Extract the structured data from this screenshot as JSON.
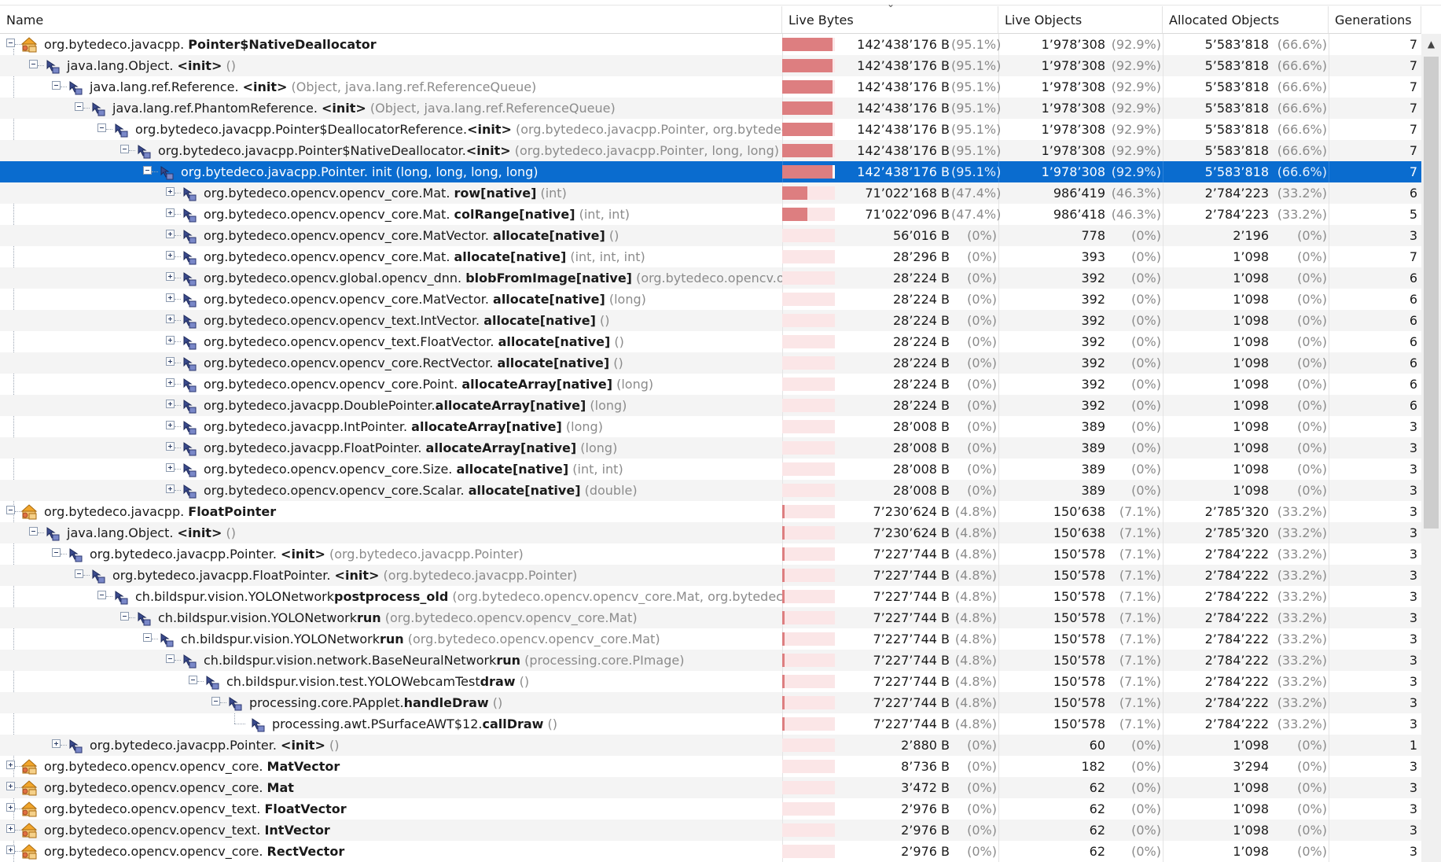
{
  "columns": {
    "name": "Name",
    "live_bytes": "Live Bytes",
    "live_objects": "Live Objects",
    "allocated_objects": "Allocated Objects",
    "generations": "Generations"
  },
  "colors": {
    "bar": "#dd7e80",
    "bar_bg": "#fbe6e7",
    "selected": "#0a6ccf"
  },
  "rows": [
    {
      "depth": 0,
      "toggle": "minus",
      "icon": "class-icon",
      "pkg": "org.bytedeco.javacpp. ",
      "meth": "Pointer$NativeDeallocator",
      "args": "",
      "bytes": "142’438’176 B",
      "bytes_pct": "(95.1%)",
      "bar": 0.95,
      "objs": "1’978’308",
      "objs_pct": "(92.9%)",
      "alloc": "5’583’818",
      "alloc_pct": "(66.6%)",
      "gen": "7"
    },
    {
      "depth": 1,
      "toggle": "minus",
      "icon": "method-icon",
      "pkg": "java.lang.Object. ",
      "meth": "<init>",
      "args": " ()",
      "bytes": "142’438’176 B",
      "bytes_pct": "(95.1%)",
      "bar": 0.95,
      "objs": "1’978’308",
      "objs_pct": "(92.9%)",
      "alloc": "5’583’818",
      "alloc_pct": "(66.6%)",
      "gen": "7"
    },
    {
      "depth": 2,
      "toggle": "minus",
      "icon": "method-icon",
      "pkg": "java.lang.ref.Reference. ",
      "meth": "<init>",
      "args": " (Object, java.lang.ref.ReferenceQueue)",
      "bytes": "142’438’176 B",
      "bytes_pct": "(95.1%)",
      "bar": 0.95,
      "objs": "1’978’308",
      "objs_pct": "(92.9%)",
      "alloc": "5’583’818",
      "alloc_pct": "(66.6%)",
      "gen": "7"
    },
    {
      "depth": 3,
      "toggle": "minus",
      "icon": "method-icon",
      "pkg": "java.lang.ref.PhantomReference. ",
      "meth": "<init>",
      "args": " (Object, java.lang.ref.ReferenceQueue)",
      "bytes": "142’438’176 B",
      "bytes_pct": "(95.1%)",
      "bar": 0.95,
      "objs": "1’978’308",
      "objs_pct": "(92.9%)",
      "alloc": "5’583’818",
      "alloc_pct": "(66.6%)",
      "gen": "7"
    },
    {
      "depth": 4,
      "toggle": "minus",
      "icon": "method-icon",
      "pkg": "org.bytedeco.javacpp.Pointer$DeallocatorReference.",
      "meth": "<init>",
      "args": " (org.bytedeco.javacpp.Pointer, org.bytedeco.java",
      "bytes": "142’438’176 B",
      "bytes_pct": "(95.1%)",
      "bar": 0.95,
      "objs": "1’978’308",
      "objs_pct": "(92.9%)",
      "alloc": "5’583’818",
      "alloc_pct": "(66.6%)",
      "gen": "7"
    },
    {
      "depth": 5,
      "toggle": "minus",
      "icon": "method-icon",
      "pkg": "org.bytedeco.javacpp.Pointer$NativeDeallocator.",
      "meth": "<init>",
      "args": " (org.bytedeco.javacpp.Pointer, long, long)",
      "bytes": "142’438’176 B",
      "bytes_pct": "(95.1%)",
      "bar": 0.95,
      "objs": "1’978’308",
      "objs_pct": "(92.9%)",
      "alloc": "5’583’818",
      "alloc_pct": "(66.6%)",
      "gen": "7"
    },
    {
      "depth": 6,
      "toggle": "minus",
      "icon": "method-icon",
      "pkg": "org.bytedeco.javacpp.Pointer. ",
      "meth": "",
      "args": "",
      "plain": "init (long, long, long, long)",
      "bytes": "142’438’176 B",
      "bytes_pct": "(95.1%)",
      "bar": 0.95,
      "objs": "1’978’308",
      "objs_pct": "(92.9%)",
      "alloc": "5’583’818",
      "alloc_pct": "(66.6%)",
      "gen": "7",
      "selected": true
    },
    {
      "depth": 7,
      "toggle": "plus",
      "icon": "method-icon",
      "pkg": "org.bytedeco.opencv.opencv_core.Mat. ",
      "meth": "row[native]",
      "args": " (int)",
      "bytes": "71’022’168 B",
      "bytes_pct": "(47.4%)",
      "bar": 0.474,
      "objs": "986’419",
      "objs_pct": "(46.3%)",
      "alloc": "2’784’223",
      "alloc_pct": "(33.2%)",
      "gen": "6"
    },
    {
      "depth": 7,
      "toggle": "plus",
      "icon": "method-icon",
      "pkg": "org.bytedeco.opencv.opencv_core.Mat. ",
      "meth": "colRange[native]",
      "args": " (int, int)",
      "bytes": "71’022’096 B",
      "bytes_pct": "(47.4%)",
      "bar": 0.474,
      "objs": "986’418",
      "objs_pct": "(46.3%)",
      "alloc": "2’784’223",
      "alloc_pct": "(33.2%)",
      "gen": "5"
    },
    {
      "depth": 7,
      "toggle": "plus",
      "icon": "method-icon",
      "pkg": "org.bytedeco.opencv.opencv_core.MatVector. ",
      "meth": "allocate[native]",
      "args": " ()",
      "bytes": "56’016 B",
      "bytes_pct": "(0%)",
      "bar": 0,
      "objs": "778",
      "objs_pct": "(0%)",
      "alloc": "2’196",
      "alloc_pct": "(0%)",
      "gen": "3"
    },
    {
      "depth": 7,
      "toggle": "plus",
      "icon": "method-icon",
      "pkg": "org.bytedeco.opencv.opencv_core.Mat. ",
      "meth": "allocate[native]",
      "args": " (int, int, int)",
      "bytes": "28’296 B",
      "bytes_pct": "(0%)",
      "bar": 0,
      "objs": "393",
      "objs_pct": "(0%)",
      "alloc": "1’098",
      "alloc_pct": "(0%)",
      "gen": "7"
    },
    {
      "depth": 7,
      "toggle": "plus",
      "icon": "method-icon",
      "pkg": "org.bytedeco.opencv.global.opencv_dnn. ",
      "meth": "blobFromImage[native]",
      "args": " (org.bytedeco.opencv.openc",
      "bytes": "28’224 B",
      "bytes_pct": "(0%)",
      "bar": 0,
      "objs": "392",
      "objs_pct": "(0%)",
      "alloc": "1’098",
      "alloc_pct": "(0%)",
      "gen": "6"
    },
    {
      "depth": 7,
      "toggle": "plus",
      "icon": "method-icon",
      "pkg": "org.bytedeco.opencv.opencv_core.MatVector. ",
      "meth": "allocate[native]",
      "args": " (long)",
      "bytes": "28’224 B",
      "bytes_pct": "(0%)",
      "bar": 0,
      "objs": "392",
      "objs_pct": "(0%)",
      "alloc": "1’098",
      "alloc_pct": "(0%)",
      "gen": "6"
    },
    {
      "depth": 7,
      "toggle": "plus",
      "icon": "method-icon",
      "pkg": "org.bytedeco.opencv.opencv_text.IntVector. ",
      "meth": "allocate[native]",
      "args": " ()",
      "bytes": "28’224 B",
      "bytes_pct": "(0%)",
      "bar": 0,
      "objs": "392",
      "objs_pct": "(0%)",
      "alloc": "1’098",
      "alloc_pct": "(0%)",
      "gen": "6"
    },
    {
      "depth": 7,
      "toggle": "plus",
      "icon": "method-icon",
      "pkg": "org.bytedeco.opencv.opencv_text.FloatVector. ",
      "meth": "allocate[native]",
      "args": " ()",
      "bytes": "28’224 B",
      "bytes_pct": "(0%)",
      "bar": 0,
      "objs": "392",
      "objs_pct": "(0%)",
      "alloc": "1’098",
      "alloc_pct": "(0%)",
      "gen": "6"
    },
    {
      "depth": 7,
      "toggle": "plus",
      "icon": "method-icon",
      "pkg": "org.bytedeco.opencv.opencv_core.RectVector. ",
      "meth": "allocate[native]",
      "args": " ()",
      "bytes": "28’224 B",
      "bytes_pct": "(0%)",
      "bar": 0,
      "objs": "392",
      "objs_pct": "(0%)",
      "alloc": "1’098",
      "alloc_pct": "(0%)",
      "gen": "6"
    },
    {
      "depth": 7,
      "toggle": "plus",
      "icon": "method-icon",
      "pkg": "org.bytedeco.opencv.opencv_core.Point. ",
      "meth": "allocateArray[native]",
      "args": " (long)",
      "bytes": "28’224 B",
      "bytes_pct": "(0%)",
      "bar": 0,
      "objs": "392",
      "objs_pct": "(0%)",
      "alloc": "1’098",
      "alloc_pct": "(0%)",
      "gen": "6"
    },
    {
      "depth": 7,
      "toggle": "plus",
      "icon": "method-icon",
      "pkg": "org.bytedeco.javacpp.DoublePointer.",
      "meth": "allocateArray[native]",
      "args": " (long)",
      "bytes": "28’224 B",
      "bytes_pct": "(0%)",
      "bar": 0,
      "objs": "392",
      "objs_pct": "(0%)",
      "alloc": "1’098",
      "alloc_pct": "(0%)",
      "gen": "6"
    },
    {
      "depth": 7,
      "toggle": "plus",
      "icon": "method-icon",
      "pkg": "org.bytedeco.javacpp.IntPointer. ",
      "meth": "allocateArray[native]",
      "args": " (long)",
      "bytes": "28’008 B",
      "bytes_pct": "(0%)",
      "bar": 0,
      "objs": "389",
      "objs_pct": "(0%)",
      "alloc": "1’098",
      "alloc_pct": "(0%)",
      "gen": "3"
    },
    {
      "depth": 7,
      "toggle": "plus",
      "icon": "method-icon",
      "pkg": "org.bytedeco.javacpp.FloatPointer. ",
      "meth": "allocateArray[native]",
      "args": " (long)",
      "bytes": "28’008 B",
      "bytes_pct": "(0%)",
      "bar": 0,
      "objs": "389",
      "objs_pct": "(0%)",
      "alloc": "1’098",
      "alloc_pct": "(0%)",
      "gen": "3"
    },
    {
      "depth": 7,
      "toggle": "plus",
      "icon": "method-icon",
      "pkg": "org.bytedeco.opencv.opencv_core.Size. ",
      "meth": "allocate[native]",
      "args": " (int, int)",
      "bytes": "28’008 B",
      "bytes_pct": "(0%)",
      "bar": 0,
      "objs": "389",
      "objs_pct": "(0%)",
      "alloc": "1’098",
      "alloc_pct": "(0%)",
      "gen": "3"
    },
    {
      "depth": 7,
      "toggle": "plus",
      "icon": "method-icon",
      "pkg": "org.bytedeco.opencv.opencv_core.Scalar. ",
      "meth": "allocate[native]",
      "args": " (double)",
      "bytes": "28’008 B",
      "bytes_pct": "(0%)",
      "bar": 0,
      "objs": "389",
      "objs_pct": "(0%)",
      "alloc": "1’098",
      "alloc_pct": "(0%)",
      "gen": "3"
    },
    {
      "depth": 0,
      "toggle": "minus",
      "icon": "class-icon",
      "pkg": "org.bytedeco.javacpp. ",
      "meth": "FloatPointer",
      "args": "",
      "bytes": "7’230’624 B",
      "bytes_pct": "(4.8%)",
      "bar": 0.048,
      "objs": "150’638",
      "objs_pct": "(7.1%)",
      "alloc": "2’785’320",
      "alloc_pct": "(33.2%)",
      "gen": "3"
    },
    {
      "depth": 1,
      "toggle": "minus",
      "icon": "method-icon",
      "pkg": "java.lang.Object. ",
      "meth": "<init>",
      "args": " ()",
      "bytes": "7’230’624 B",
      "bytes_pct": "(4.8%)",
      "bar": 0.048,
      "objs": "150’638",
      "objs_pct": "(7.1%)",
      "alloc": "2’785’320",
      "alloc_pct": "(33.2%)",
      "gen": "3"
    },
    {
      "depth": 2,
      "toggle": "minus",
      "icon": "method-icon",
      "pkg": "org.bytedeco.javacpp.Pointer. ",
      "meth": "<init>",
      "args": " (org.bytedeco.javacpp.Pointer)",
      "bytes": "7’227’744 B",
      "bytes_pct": "(4.8%)",
      "bar": 0.048,
      "objs": "150’578",
      "objs_pct": "(7.1%)",
      "alloc": "2’784’222",
      "alloc_pct": "(33.2%)",
      "gen": "3"
    },
    {
      "depth": 3,
      "toggle": "minus",
      "icon": "method-icon",
      "pkg": "org.bytedeco.javacpp.FloatPointer. ",
      "meth": "<init>",
      "args": " (org.bytedeco.javacpp.Pointer)",
      "bytes": "7’227’744 B",
      "bytes_pct": "(4.8%)",
      "bar": 0.048,
      "objs": "150’578",
      "objs_pct": "(7.1%)",
      "alloc": "2’784’222",
      "alloc_pct": "(33.2%)",
      "gen": "3"
    },
    {
      "depth": 4,
      "toggle": "minus",
      "icon": "method-icon",
      "pkg": "ch.bildspur.vision.YOLONetwork",
      "meth": "postprocess_old",
      "args": " (org.bytedeco.opencv.opencv_core.Mat, org.bytedeco.ope",
      "bytes": "7’227’744 B",
      "bytes_pct": "(4.8%)",
      "bar": 0.048,
      "objs": "150’578",
      "objs_pct": "(7.1%)",
      "alloc": "2’784’222",
      "alloc_pct": "(33.2%)",
      "gen": "3"
    },
    {
      "depth": 5,
      "toggle": "minus",
      "icon": "method-icon",
      "pkg": "ch.bildspur.vision.YOLONetwork",
      "meth": "run",
      "args": " (org.bytedeco.opencv.opencv_core.Mat)",
      "bytes": "7’227’744 B",
      "bytes_pct": "(4.8%)",
      "bar": 0.048,
      "objs": "150’578",
      "objs_pct": "(7.1%)",
      "alloc": "2’784’222",
      "alloc_pct": "(33.2%)",
      "gen": "3"
    },
    {
      "depth": 6,
      "toggle": "minus",
      "icon": "method-icon",
      "pkg": "ch.bildspur.vision.YOLONetwork",
      "meth": "run",
      "args": " (org.bytedeco.opencv.opencv_core.Mat)",
      "bytes": "7’227’744 B",
      "bytes_pct": "(4.8%)",
      "bar": 0.048,
      "objs": "150’578",
      "objs_pct": "(7.1%)",
      "alloc": "2’784’222",
      "alloc_pct": "(33.2%)",
      "gen": "3"
    },
    {
      "depth": 7,
      "toggle": "minus",
      "icon": "method-icon",
      "pkg": "ch.bildspur.vision.network.BaseNeuralNetwork",
      "meth": "run",
      "args": " (processing.core.PImage)",
      "bytes": "7’227’744 B",
      "bytes_pct": "(4.8%)",
      "bar": 0.048,
      "objs": "150’578",
      "objs_pct": "(7.1%)",
      "alloc": "2’784’222",
      "alloc_pct": "(33.2%)",
      "gen": "3"
    },
    {
      "depth": 8,
      "toggle": "minus",
      "icon": "method-icon",
      "pkg": "ch.bildspur.vision.test.YOLOWebcamTest",
      "meth": "draw",
      "args": " ()",
      "bytes": "7’227’744 B",
      "bytes_pct": "(4.8%)",
      "bar": 0.048,
      "objs": "150’578",
      "objs_pct": "(7.1%)",
      "alloc": "2’784’222",
      "alloc_pct": "(33.2%)",
      "gen": "3"
    },
    {
      "depth": 9,
      "toggle": "minus",
      "icon": "method-icon",
      "pkg": "processing.core.PApplet.",
      "meth": "handleDraw",
      "args": " ()",
      "bytes": "7’227’744 B",
      "bytes_pct": "(4.8%)",
      "bar": 0.048,
      "objs": "150’578",
      "objs_pct": "(7.1%)",
      "alloc": "2’784’222",
      "alloc_pct": "(33.2%)",
      "gen": "3"
    },
    {
      "depth": 10,
      "toggle": "leaf",
      "icon": "method-icon",
      "pkg": "processing.awt.PSurfaceAWT$12.",
      "meth": "callDraw",
      "args": " ()",
      "bytes": "7’227’744 B",
      "bytes_pct": "(4.8%)",
      "bar": 0.048,
      "objs": "150’578",
      "objs_pct": "(7.1%)",
      "alloc": "2’784’222",
      "alloc_pct": "(33.2%)",
      "gen": "3"
    },
    {
      "depth": 2,
      "toggle": "plus",
      "icon": "method-icon",
      "pkg": "org.bytedeco.javacpp.Pointer. ",
      "meth": "<init>",
      "args": " ()",
      "bytes": "2’880 B",
      "bytes_pct": "(0%)",
      "bar": 0,
      "objs": "60",
      "objs_pct": "(0%)",
      "alloc": "1’098",
      "alloc_pct": "(0%)",
      "gen": "1"
    },
    {
      "depth": 0,
      "toggle": "plus",
      "icon": "class-icon",
      "pkg": "org.bytedeco.opencv.opencv_core. ",
      "meth": "MatVector",
      "args": "",
      "bytes": "8’736 B",
      "bytes_pct": "(0%)",
      "bar": 0,
      "objs": "182",
      "objs_pct": "(0%)",
      "alloc": "3’294",
      "alloc_pct": "(0%)",
      "gen": "3"
    },
    {
      "depth": 0,
      "toggle": "plus",
      "icon": "class-icon",
      "pkg": "org.bytedeco.opencv.opencv_core. ",
      "meth": "Mat",
      "args": "",
      "bytes": "3’472 B",
      "bytes_pct": "(0%)",
      "bar": 0,
      "objs": "62",
      "objs_pct": "(0%)",
      "alloc": "1’098",
      "alloc_pct": "(0%)",
      "gen": "3"
    },
    {
      "depth": 0,
      "toggle": "plus",
      "icon": "class-icon",
      "pkg": "org.bytedeco.opencv.opencv_text. ",
      "meth": "FloatVector",
      "args": "",
      "bytes": "2’976 B",
      "bytes_pct": "(0%)",
      "bar": 0,
      "objs": "62",
      "objs_pct": "(0%)",
      "alloc": "1’098",
      "alloc_pct": "(0%)",
      "gen": "3"
    },
    {
      "depth": 0,
      "toggle": "plus",
      "icon": "class-icon",
      "pkg": "org.bytedeco.opencv.opencv_text. ",
      "meth": "IntVector",
      "args": "",
      "bytes": "2’976 B",
      "bytes_pct": "(0%)",
      "bar": 0,
      "objs": "62",
      "objs_pct": "(0%)",
      "alloc": "1’098",
      "alloc_pct": "(0%)",
      "gen": "3"
    },
    {
      "depth": 0,
      "toggle": "plus",
      "icon": "class-icon",
      "pkg": "org.bytedeco.opencv.opencv_core. ",
      "meth": "RectVector",
      "args": "",
      "bytes": "2’976 B",
      "bytes_pct": "(0%)",
      "bar": 0,
      "objs": "62",
      "objs_pct": "(0%)",
      "alloc": "1’098",
      "alloc_pct": "(0%)",
      "gen": "3"
    }
  ]
}
